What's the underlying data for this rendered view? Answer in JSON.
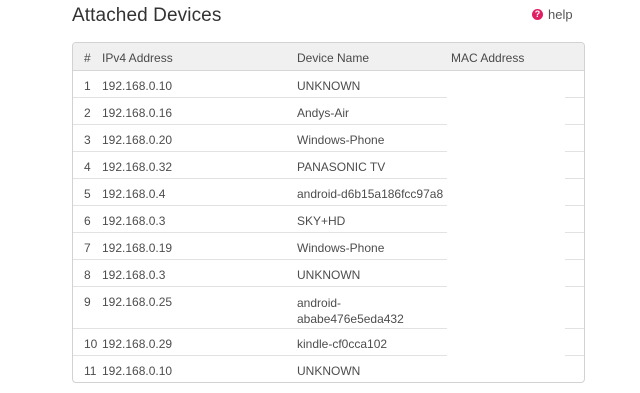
{
  "page": {
    "title": "Attached Devices",
    "help_label": "help",
    "help_icon": "question-circle-icon",
    "accent_color": "#e01e63"
  },
  "table": {
    "headers": {
      "num": "#",
      "ip": "IPv4 Address",
      "name": "Device Name",
      "mac": "MAC Address"
    },
    "rows": [
      {
        "num": "1",
        "ip": "192.168.0.10",
        "name": "UNKNOWN",
        "mac": ""
      },
      {
        "num": "2",
        "ip": "192.168.0.16",
        "name": "Andys-Air",
        "mac": ""
      },
      {
        "num": "3",
        "ip": "192.168.0.20",
        "name": "Windows-Phone",
        "mac": ""
      },
      {
        "num": "4",
        "ip": "192.168.0.32",
        "name": "PANASONIC TV",
        "mac": ""
      },
      {
        "num": "5",
        "ip": "192.168.0.4",
        "name": "android-d6b15a186fcc97a8",
        "mac": ""
      },
      {
        "num": "6",
        "ip": "192.168.0.3",
        "name": "SKY+HD",
        "mac": ""
      },
      {
        "num": "7",
        "ip": "192.168.0.19",
        "name": "Windows-Phone",
        "mac": ""
      },
      {
        "num": "8",
        "ip": "192.168.0.3",
        "name": "UNKNOWN",
        "mac": ""
      },
      {
        "num": "9",
        "ip": "192.168.0.25",
        "name": "android-ababe476e5eda432",
        "mac": ""
      },
      {
        "num": "10",
        "ip": "192.168.0.29",
        "name": "kindle-cf0cca102",
        "mac": ""
      },
      {
        "num": "11",
        "ip": "192.168.0.10",
        "name": "UNKNOWN",
        "mac": ""
      }
    ]
  }
}
